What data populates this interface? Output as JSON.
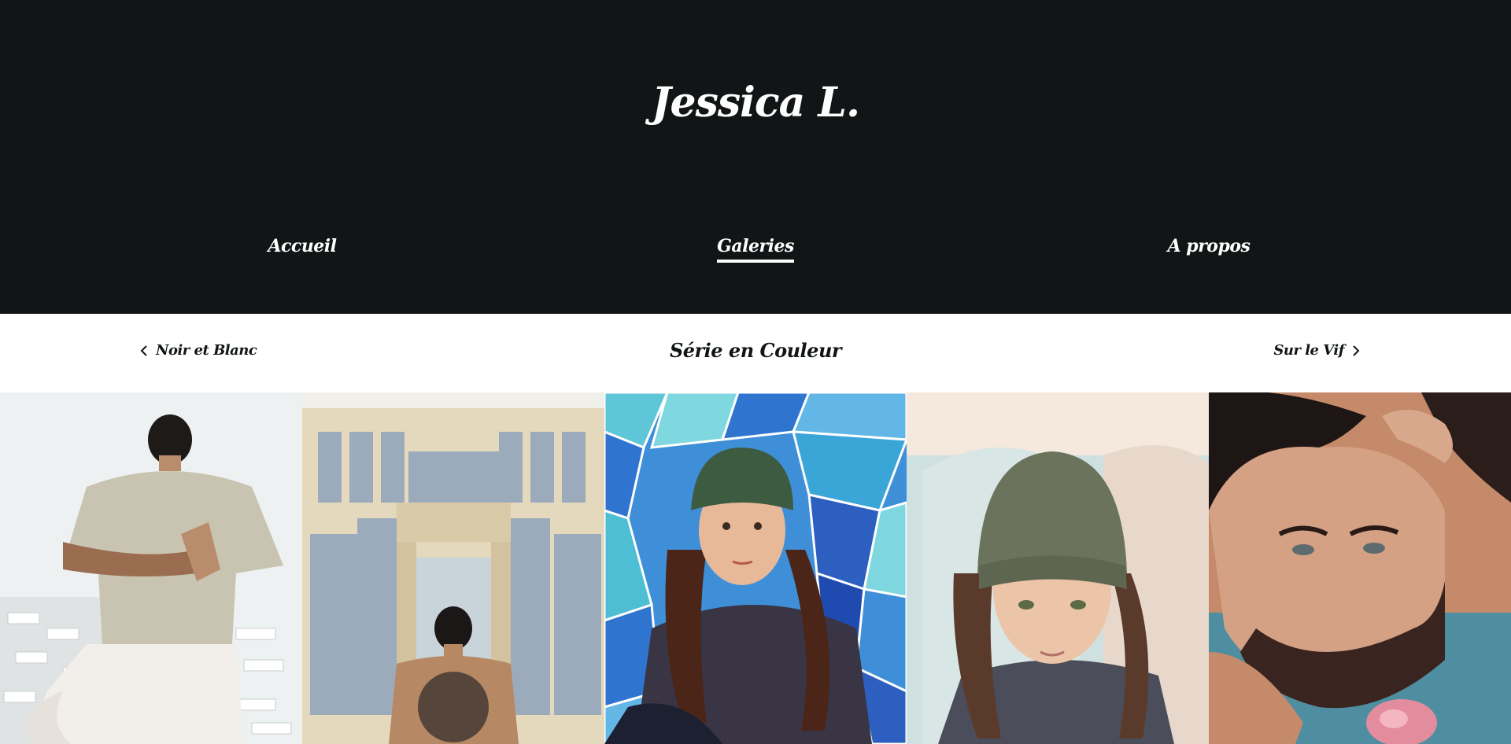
{
  "site": {
    "title": "Jessica L."
  },
  "nav": {
    "items": [
      {
        "label": "Accueil",
        "active": false
      },
      {
        "label": "Galeries",
        "active": true
      },
      {
        "label": "A propos",
        "active": false
      }
    ]
  },
  "gallery": {
    "title": "Série en Couleur",
    "prev_label": "Noir et Blanc",
    "next_label": "Sur le Vif"
  },
  "photos": [
    {
      "subject": "man-yoga-pose-back"
    },
    {
      "subject": "man-tattoo-back-building"
    },
    {
      "subject": "woman-beanie-mosaic-wall"
    },
    {
      "subject": "woman-beanie-portrait"
    },
    {
      "subject": "bearded-man-portrait"
    }
  ],
  "colors": {
    "header_bg": "#111516",
    "header_text": "#ffffff",
    "body_text": "#111516"
  }
}
